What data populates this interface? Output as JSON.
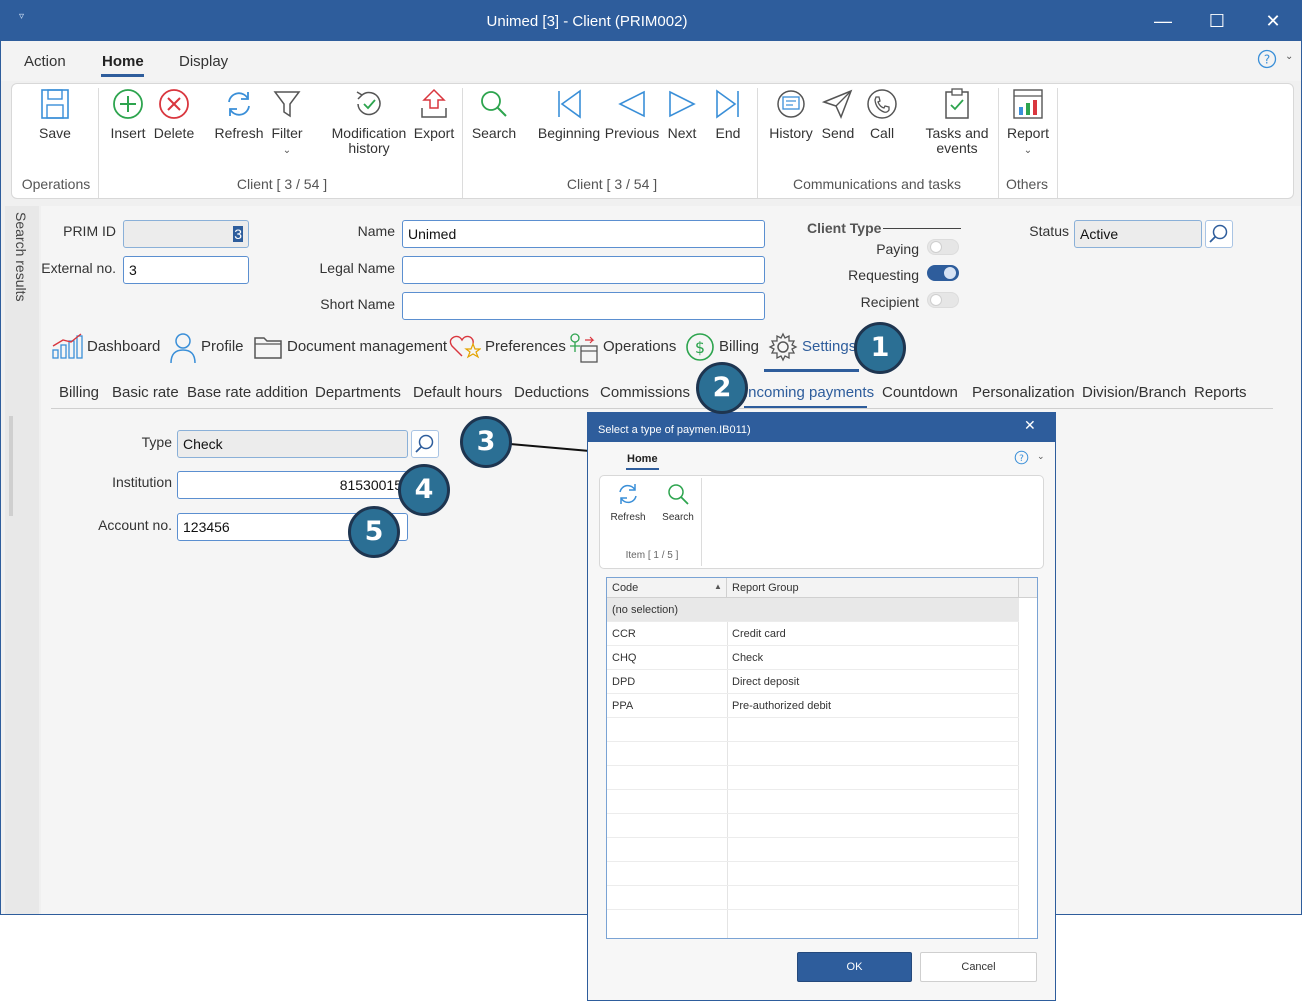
{
  "window": {
    "title": "Unimed [3] - Client (PRIM002)",
    "minimize": "—",
    "maximize": "☐",
    "close": "✕"
  },
  "menu": {
    "tabs": [
      "Action",
      "Home",
      "Display"
    ],
    "active": "Home"
  },
  "ribbon": {
    "save": "Save",
    "insert": "Insert",
    "delete": "Delete",
    "refresh": "Refresh",
    "filter": "Filter",
    "modification_history_1": "Modification",
    "modification_history_2": "history",
    "export": "Export",
    "search": "Search",
    "beginning": "Beginning",
    "previous": "Previous",
    "next": "Next",
    "end": "End",
    "history": "History",
    "send": "Send",
    "call": "Call",
    "tasks_1": "Tasks and",
    "tasks_2": "events",
    "report": "Report",
    "group_operations": "Operations",
    "group_client_1": "Client [ 3 / 54 ]",
    "group_client_2": "Client [ 3 / 54 ]",
    "group_comms": "Communications and tasks",
    "group_others": "Others"
  },
  "sidebar": {
    "label": "Search results"
  },
  "form": {
    "prim_id_label": "PRIM ID",
    "prim_id_value": "3",
    "external_no_label": "External no.",
    "external_no_value": "3",
    "name_label": "Name",
    "name_value": "Unimed",
    "legal_name_label": "Legal Name",
    "legal_name_value": "",
    "short_name_label": "Short Name",
    "short_name_value": "",
    "client_type_label": "Client Type",
    "paying_label": "Paying",
    "requesting_label": "Requesting",
    "recipient_label": "Recipient",
    "paying_on": false,
    "requesting_on": true,
    "recipient_on": false,
    "status_label": "Status",
    "status_value": "Active"
  },
  "main_tabs": {
    "dashboard": "Dashboard",
    "profile": "Profile",
    "documents": "Document management",
    "preferences": "Preferences",
    "operations": "Operations",
    "billing": "Billing",
    "settings": "Settings",
    "active": "Settings"
  },
  "sub_tabs": {
    "billing": "Billing",
    "basic_rate": "Basic rate",
    "base_rate_addition": "Base rate addition",
    "departments": "Departments",
    "default_hours": "Default hours",
    "deductions": "Deductions",
    "commissions": "Commissions",
    "incoming_payments": "Incoming payments",
    "countdown": "Countdown",
    "personalization": "Personalization",
    "division_branch": "Division/Branch",
    "reports": "Reports",
    "active": "Incoming payments"
  },
  "payment": {
    "type_label": "Type",
    "type_value": "Check",
    "institution_label": "Institution",
    "institution_value": "81530015",
    "account_label": "Account no.",
    "account_value": "123456"
  },
  "badges": {
    "b1": "1",
    "b2": "2",
    "b3": "3",
    "b4": "4",
    "b5": "5"
  },
  "dialog": {
    "title": "Select a type of paymen.IB011)",
    "tab_home": "Home",
    "refresh": "Refresh",
    "search": "Search",
    "item_count": "Item [ 1 / 5 ]",
    "col_code": "Code",
    "col_report_group": "Report Group",
    "rows": [
      {
        "code": "(no selection)",
        "group": ""
      },
      {
        "code": "CCR",
        "group": "Credit card"
      },
      {
        "code": "CHQ",
        "group": "Check"
      },
      {
        "code": "DPD",
        "group": "Direct deposit"
      },
      {
        "code": "PPA",
        "group": "Pre-authorized debit"
      }
    ],
    "ok": "OK",
    "cancel": "Cancel"
  },
  "colors": {
    "accent": "#2e5d9c",
    "badge": "#2b6f94",
    "icon": "#3a8fd8",
    "add": "#2da44e",
    "delete": "#d9363e"
  }
}
